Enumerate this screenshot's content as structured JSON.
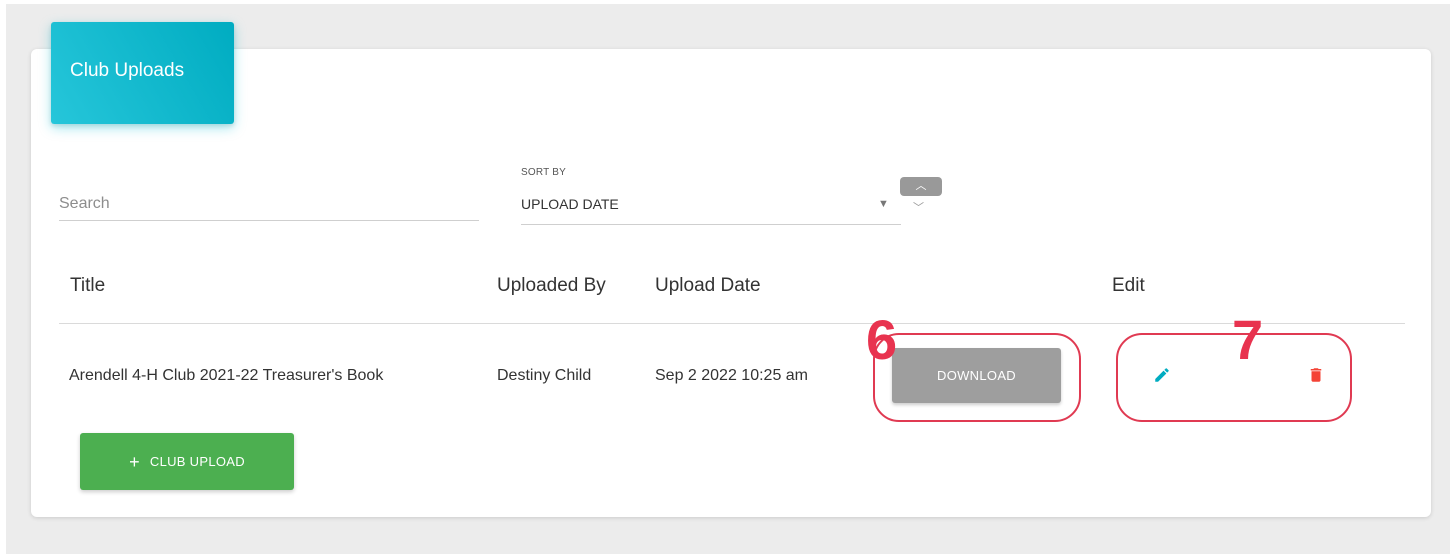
{
  "card": {
    "title": "Club Uploads",
    "header_color": "#00acc1"
  },
  "filters": {
    "search_placeholder": "Search",
    "sort_label": "SORT BY",
    "sort_value": "UPLOAD DATE",
    "sort_up_icon": "chevron-up-icon",
    "sort_down_icon": "chevron-down-icon"
  },
  "table": {
    "columns": [
      "Title",
      "Uploaded By",
      "Upload Date",
      "Edit"
    ],
    "rows": [
      {
        "title": "Arendell 4-H Club 2021-22 Treasurer's Book",
        "uploaded_by": "Destiny Child",
        "upload_date": "Sep 2 2022 10:25 am",
        "download_label": "DOWNLOAD",
        "edit_icon": "pencil-icon",
        "delete_icon": "trash-icon"
      }
    ]
  },
  "actions": {
    "add_label": "CLUB UPLOAD",
    "add_icon": "plus-icon",
    "add_color": "#4caf50"
  },
  "annotations": {
    "callout_download": "6",
    "callout_edit": "7",
    "callout_color": "#e8334f"
  },
  "colors": {
    "edit_icon": "#00acc1",
    "delete_icon": "#f44336",
    "download_button": "#9e9e9e"
  }
}
